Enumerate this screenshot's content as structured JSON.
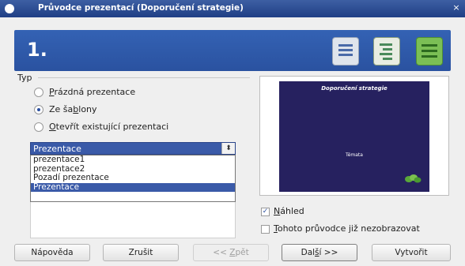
{
  "window": {
    "title": "Průvodce prezentací (Doporučení strategie)",
    "close_glyph": "×"
  },
  "banner": {
    "step": "1.",
    "icons": [
      "list-icon",
      "outline-icon",
      "green-notes-icon"
    ]
  },
  "type_group": {
    "label": "Typ",
    "options": [
      {
        "pre": "",
        "key": "P",
        "post": "rázdná prezentace",
        "selected": false
      },
      {
        "pre": "Ze ša",
        "key": "b",
        "post": "lony",
        "selected": true
      },
      {
        "pre": "",
        "key": "O",
        "post": "tevřít existující prezentaci",
        "selected": false
      }
    ]
  },
  "template_select": {
    "value": "Prezentace",
    "arrow": "⬍",
    "options": [
      "prezentace1",
      "prezentace2",
      "Pozadí prezentace",
      "Prezentace"
    ],
    "highlighted_index": 3
  },
  "preview": {
    "slide_title": "Doporučení strategie",
    "slide_body": "Témata",
    "deco_icon": "leaf-cluster-icon"
  },
  "checkboxes": [
    {
      "key": "N",
      "post": "áhled",
      "checked": true,
      "mark": "✓"
    },
    {
      "key": "T",
      "post": "ohoto průvodce již nezobrazovat",
      "checked": false,
      "mark": ""
    }
  ],
  "buttons": {
    "help": "Nápověda",
    "cancel": "Zrušit",
    "back_pre": "<< ",
    "back_key": "Z",
    "back_post": "pět",
    "next_pre": "Dal",
    "next_key": "š",
    "next_post": "í >>",
    "create": "Vytvořit"
  },
  "colors": {
    "banner": "#3462b4",
    "select_highlight": "#3a5aa8",
    "slide_bg": "#26215f"
  }
}
